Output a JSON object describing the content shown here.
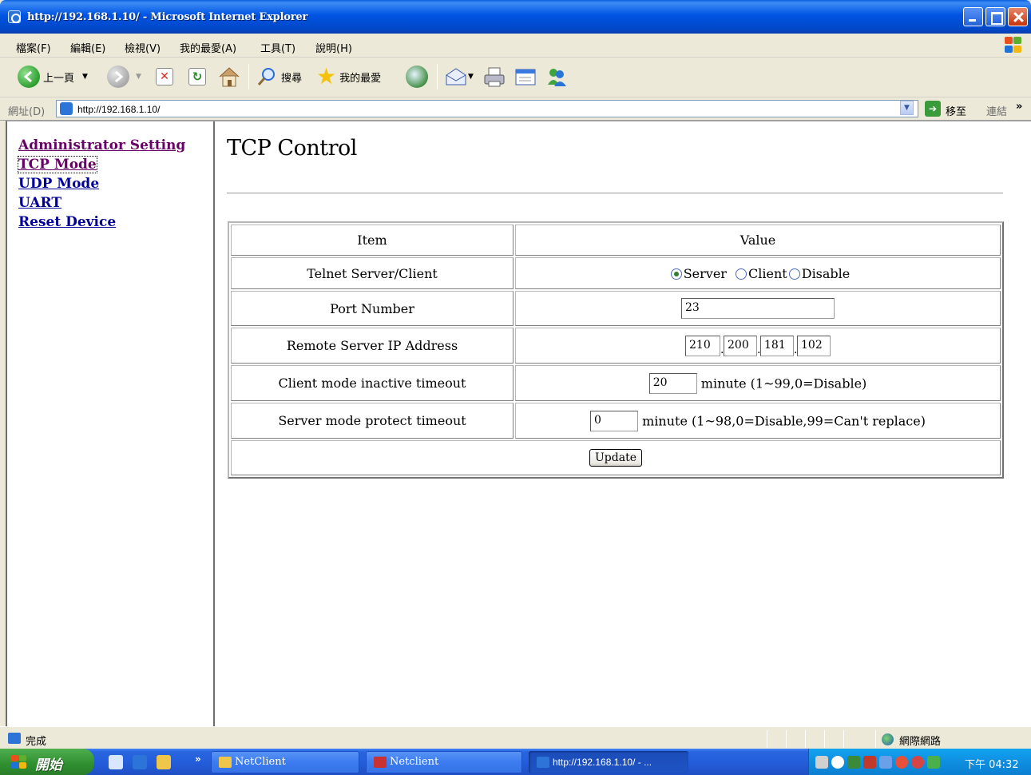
{
  "window": {
    "title": "http://192.168.1.10/ - Microsoft Internet Explorer"
  },
  "menu": [
    "檔案(F)",
    "編輯(E)",
    "檢視(V)",
    "我的最愛(A)",
    "工具(T)",
    "說明(H)"
  ],
  "toolbar": {
    "back_label": "上一頁",
    "search_label": "搜尋",
    "favorites_label": "我的最愛"
  },
  "address": {
    "label": "網址(D)",
    "url": "http://192.168.1.10/",
    "go_label": "移至",
    "links_label": "連結",
    "more": "»"
  },
  "nav": {
    "items": [
      "Administrator Setting",
      "TCP Mode",
      "UDP Mode",
      "UART",
      "Reset Device"
    ]
  },
  "page": {
    "title": "TCP Control"
  },
  "table": {
    "headers": {
      "item": "Item",
      "value": "Value"
    },
    "rows": {
      "telnet": {
        "label": "Telnet Server/Client",
        "options": [
          "Server",
          "Client",
          "Disable"
        ],
        "selected": "Server"
      },
      "port": {
        "label": "Port Number",
        "value": "23"
      },
      "remote_ip": {
        "label": "Remote Server IP Address",
        "octets": [
          "210",
          "200",
          "181",
          "102"
        ]
      },
      "client_timeout": {
        "label": "Client mode inactive timeout",
        "value": "20",
        "hint": "minute (1~99,0=Disable)"
      },
      "server_timeout": {
        "label": "Server mode protect timeout",
        "value": "0",
        "hint": "minute (1~98,0=Disable,99=Can't replace)"
      }
    },
    "update_label": "Update"
  },
  "status": {
    "text": "完成",
    "zone": "網際網路"
  },
  "taskbar": {
    "start_label": "開始",
    "more": "»",
    "tasks": [
      "NetClient",
      "Netclient",
      "http://192.168.1.10/ - ..."
    ],
    "clock": "下午 04:32"
  },
  "colors": {
    "title_bar": "#0054e3",
    "link": "#000099",
    "visited_link": "#660066",
    "taskbar": "#245edb",
    "start_button": "#2f8f2f"
  }
}
